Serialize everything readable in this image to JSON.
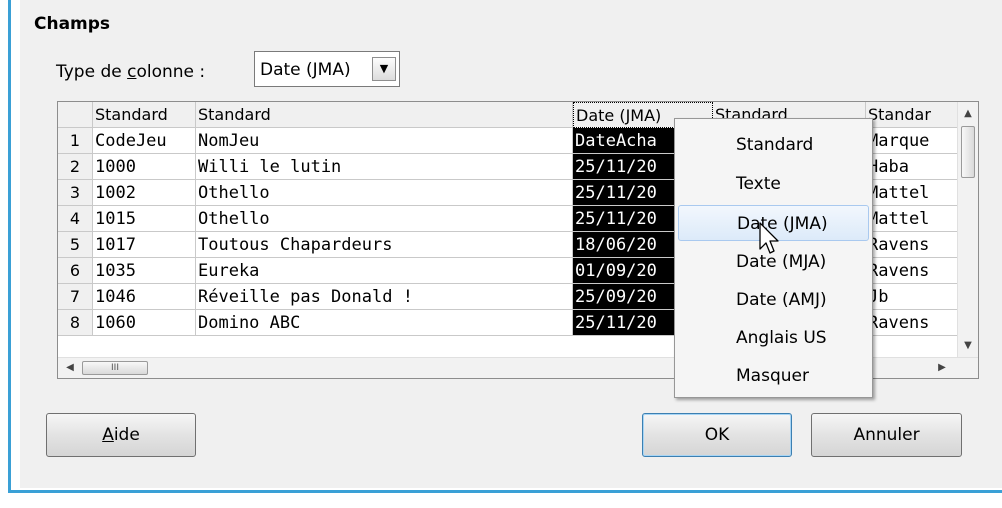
{
  "section_title": "Champs",
  "column_type": {
    "label_pre": "Type de ",
    "label_underlined": "c",
    "label_post": "olonne :",
    "value": "Date (JMA)"
  },
  "grid": {
    "headers": [
      "Standard",
      "Standard",
      "Date (JMA)",
      "Standard",
      "Standar"
    ],
    "rows": [
      {
        "num": "1",
        "cells": [
          "CodeJeu",
          "NomJeu",
          "DateAcha",
          "",
          "Marque"
        ]
      },
      {
        "num": "2",
        "cells": [
          "1000",
          "Willi le lutin",
          "25/11/20",
          "",
          "Haba"
        ]
      },
      {
        "num": "3",
        "cells": [
          "1002",
          "Othello",
          "25/11/20",
          "",
          "Mattel"
        ]
      },
      {
        "num": "4",
        "cells": [
          "1015",
          "Othello",
          "25/11/20",
          "",
          "Mattel"
        ]
      },
      {
        "num": "5",
        "cells": [
          "1017",
          "Toutous Chapardeurs",
          "18/06/20",
          "",
          "Ravens"
        ]
      },
      {
        "num": "6",
        "cells": [
          "1035",
          "Eureka",
          "01/09/20",
          "",
          "Ravens"
        ]
      },
      {
        "num": "7",
        "cells": [
          "1046",
          "Réveille pas Donald !",
          "25/09/20",
          "",
          "Jb"
        ]
      },
      {
        "num": "8",
        "cells": [
          "1060",
          "Domino ABC",
          "25/11/20",
          "",
          "Ravens"
        ]
      }
    ],
    "hscroll_thumb_glyph": "III"
  },
  "context_menu": {
    "items": [
      "Standard",
      "Texte",
      "Date (JMA)",
      "Date (MJA)",
      "Date (AMJ)",
      "Anglais US",
      "Masquer"
    ],
    "hovered": "Date (JMA)"
  },
  "buttons": {
    "help": {
      "underlined": "A",
      "rest": "ide"
    },
    "ok": "OK",
    "cancel": "Annuler"
  },
  "colors": {
    "accent_frame": "#3aa0d6",
    "menu_hover": "#dceaf9",
    "selected_column": "#000000"
  }
}
